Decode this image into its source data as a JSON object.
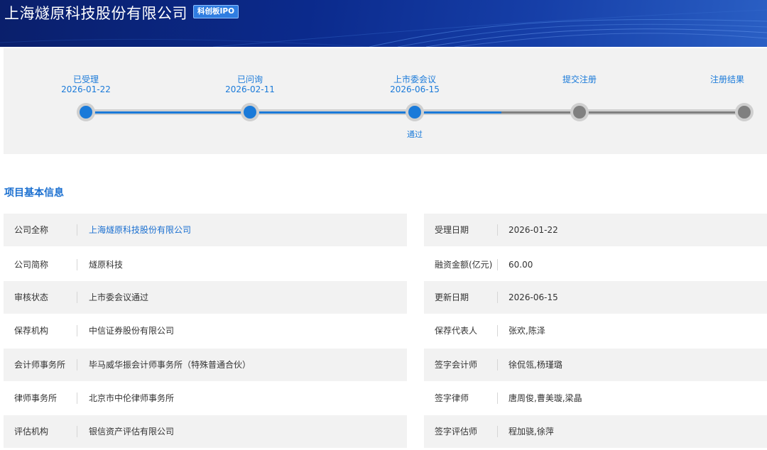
{
  "header": {
    "company_title": "上海燧原科技股份有限公司",
    "board_badge": "科创板IPO"
  },
  "progress": {
    "steps": [
      {
        "label": "已受理",
        "date": "2026-01-22",
        "status": "done",
        "sub": ""
      },
      {
        "label": "已问询",
        "date": "2026-02-11",
        "status": "done",
        "sub": ""
      },
      {
        "label": "上市委会议",
        "date": "2026-06-15",
        "status": "done",
        "sub": "通过"
      },
      {
        "label": "提交注册",
        "date": "",
        "status": "todo",
        "sub": ""
      },
      {
        "label": "注册结果",
        "date": "",
        "status": "todo",
        "sub": ""
      }
    ]
  },
  "section_title": "项目基本信息",
  "info_left": [
    {
      "label": "公司全称",
      "value": "上海燧原科技股份有限公司"
    },
    {
      "label": "公司简称",
      "value": "燧原科技"
    },
    {
      "label": "审核状态",
      "value": "上市委会议通过"
    },
    {
      "label": "保荐机构",
      "value": "中信证券股份有限公司"
    },
    {
      "label": "会计师事务所",
      "value": "毕马威华振会计师事务所（特殊普通合伙）"
    },
    {
      "label": "律师事务所",
      "value": "北京市中伦律师事务所"
    },
    {
      "label": "评估机构",
      "value": "银信资产评估有限公司"
    }
  ],
  "info_right": [
    {
      "label": "受理日期",
      "value": "2026-01-22"
    },
    {
      "label": "融资金额(亿元)",
      "value": "60.00"
    },
    {
      "label": "更新日期",
      "value": "2026-06-15"
    },
    {
      "label": "保荐代表人",
      "value": "张欢,陈泽"
    },
    {
      "label": "签字会计师",
      "value": "徐侃瓴,杨瑾璐"
    },
    {
      "label": "签字律师",
      "value": "唐周俊,曹美璇,梁晶"
    },
    {
      "label": "签字评估师",
      "value": "程加骁,徐萍"
    }
  ],
  "colors": {
    "accent_blue": "#1a7ad9",
    "pending_gray": "#808080",
    "header_navy": "#0b2a8c"
  }
}
